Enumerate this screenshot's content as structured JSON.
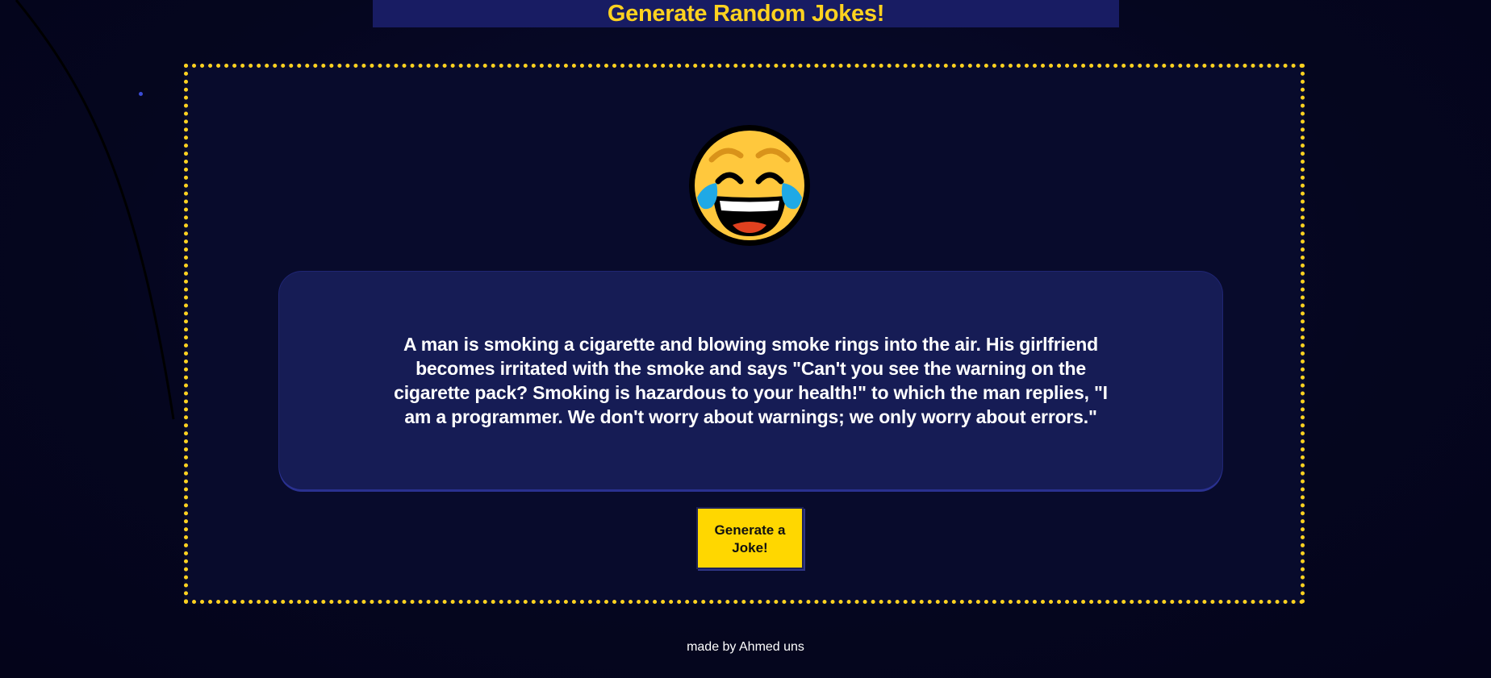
{
  "header": {
    "title": "Generate Random Jokes!"
  },
  "emoji": {
    "icon": "face-with-tears-of-joy-icon"
  },
  "joke": {
    "text": "A man is smoking a cigarette and blowing smoke rings into the air. His girlfriend becomes irritated with the smoke and says \"Can't you see the warning on the cigarette pack? Smoking is hazardous to your health!\" to which the man replies, \"I am a programmer. We don't worry about warnings; we only worry about errors.\""
  },
  "button": {
    "label": "Generate a Joke!"
  },
  "footer": {
    "credit": "made by Ahmed uns"
  },
  "colors": {
    "background": "#05061f",
    "accent": "#ffd21f",
    "card": "#161c55",
    "header_bar": "#181c63",
    "button": "#ffd700"
  }
}
